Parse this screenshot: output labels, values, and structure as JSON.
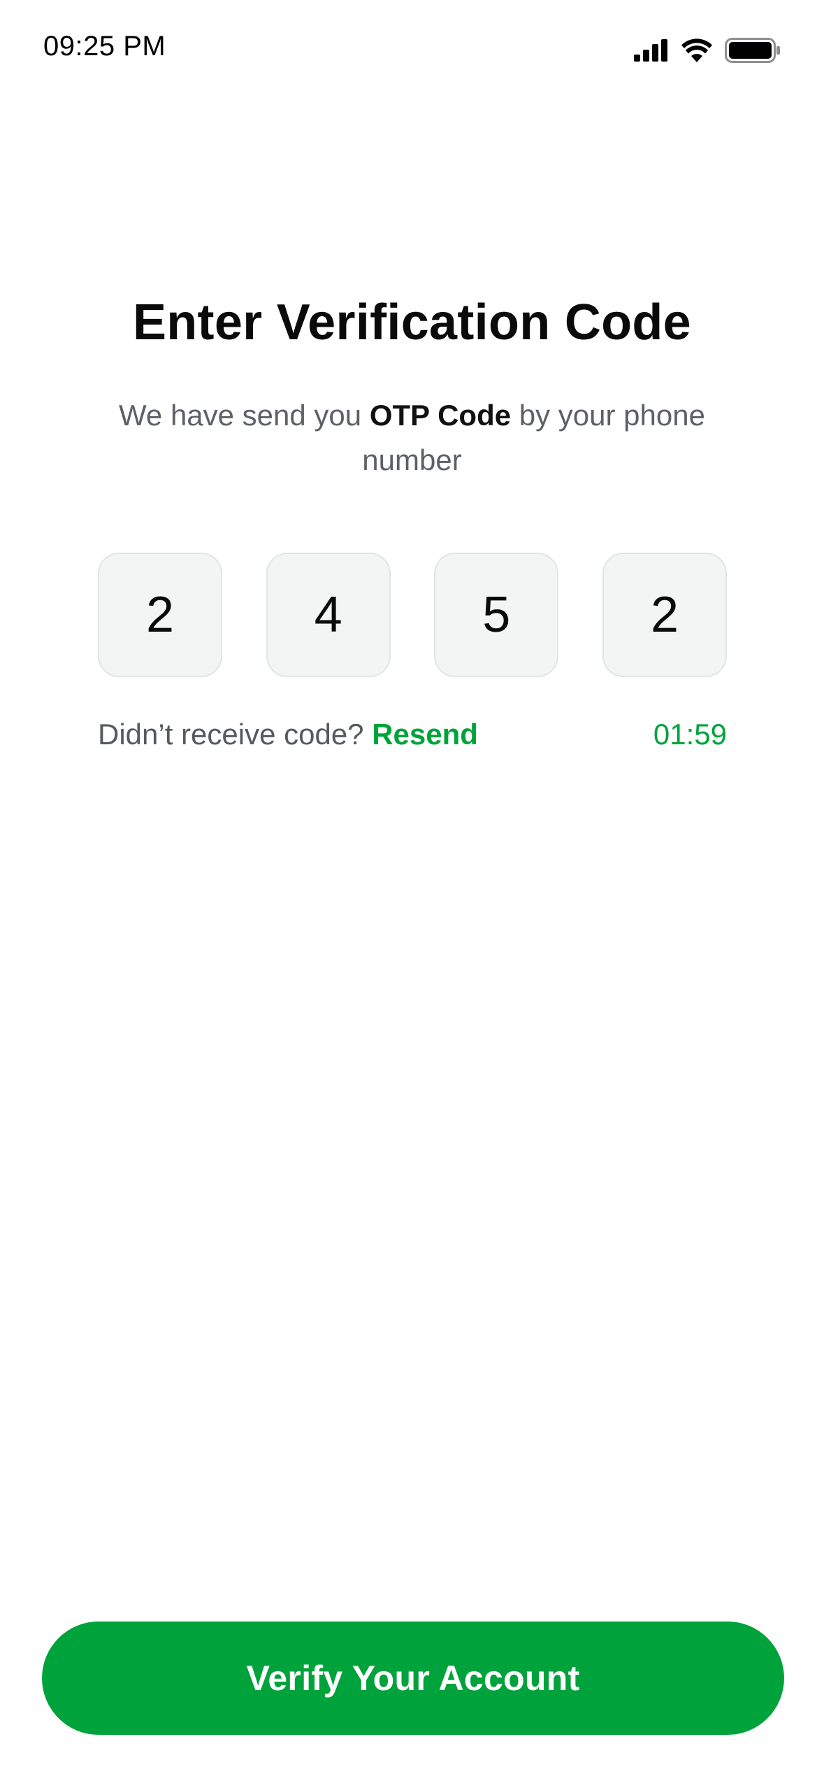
{
  "status_bar": {
    "time": "09:25 PM",
    "icons": [
      "cellular-signal-icon",
      "wifi-icon",
      "battery-icon"
    ]
  },
  "verification": {
    "title": "Enter Verification Code",
    "subtitle_pre": "We have send you ",
    "subtitle_strong": "OTP Code",
    "subtitle_post": " by your phone number",
    "otp_digits": [
      "2",
      "4",
      "5",
      "2"
    ]
  },
  "resend": {
    "prompt": "Didn’t receive code? ",
    "link_label": "Resend",
    "timer": "01:59"
  },
  "actions": {
    "verify_label": "Verify Your Account"
  },
  "colors": {
    "accent": "#00a33b",
    "otp_box_bg": "#f3f4f4",
    "otp_box_border": "#dfe7e3",
    "subtitle_text": "#5d6167"
  }
}
